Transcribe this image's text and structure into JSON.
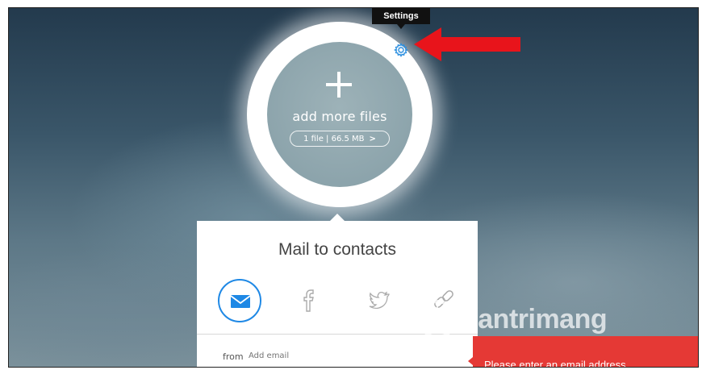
{
  "tooltip": {
    "label": "Settings"
  },
  "uploader": {
    "add_label": "add more files",
    "file_summary": "1 file | 66.5 MB",
    "chevron": ">"
  },
  "panel": {
    "title": "Mail to contacts",
    "share_options": [
      {
        "icon": "email-icon",
        "active": true
      },
      {
        "icon": "facebook-icon",
        "active": false
      },
      {
        "icon": "twitter-icon",
        "active": false
      },
      {
        "icon": "link-icon",
        "active": false
      }
    ],
    "from_label": "from",
    "from_placeholder": "Add email"
  },
  "error": {
    "message": "Please enter an email address"
  },
  "watermark": {
    "text": "uantrimang"
  },
  "colors": {
    "accent": "#1e88e5",
    "error": "#e53935",
    "arrow": "#e8141b",
    "tooltip_bg": "#111111"
  }
}
